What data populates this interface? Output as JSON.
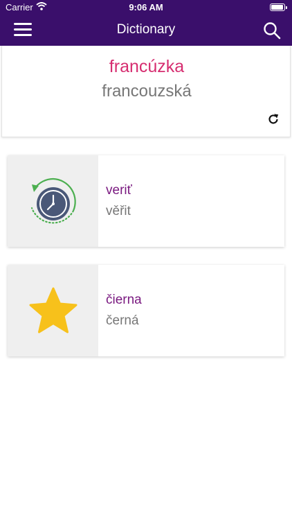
{
  "status_bar": {
    "carrier": "Carrier",
    "time": "9:06 AM"
  },
  "nav": {
    "title": "Dictionary",
    "menu_icon": "hamburger-menu-icon",
    "search_icon": "search-icon"
  },
  "word_of_day": {
    "source_word": "francúzka",
    "translation": "francouzská",
    "refresh_icon": "refresh-icon"
  },
  "history_card": {
    "icon": "clock-history-icon",
    "word": "veriť",
    "translation": "věřit"
  },
  "favorite_card": {
    "icon": "star-icon",
    "word": "čierna",
    "translation": "černá"
  },
  "colors": {
    "header": "#3a0f6b",
    "source_word": "#d62d70",
    "card_word": "#7a1a80",
    "translation": "#777777",
    "star": "#f7c11b",
    "clock_face": "#4a5878",
    "history_arrow": "#4caf50"
  }
}
